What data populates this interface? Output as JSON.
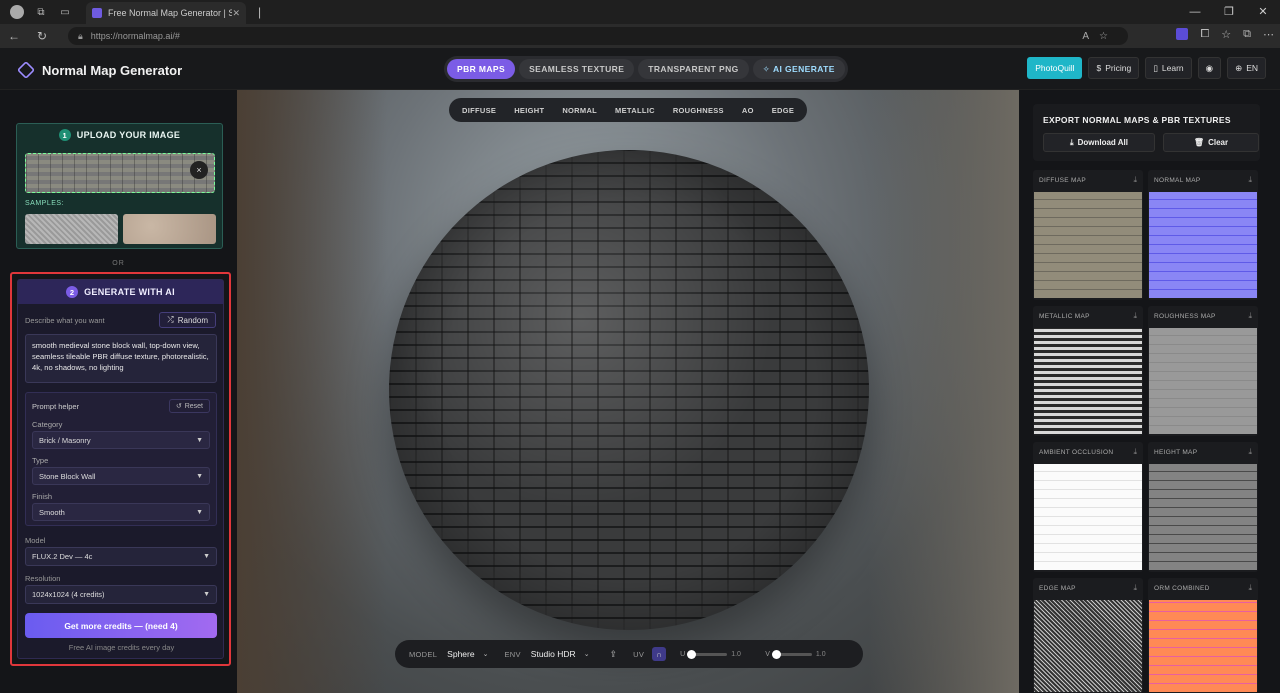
{
  "browser": {
    "tab_title": "Free Normal Map Generator | Sea",
    "tab_close": "✕",
    "url": "https://normalmap.ai/#",
    "window_buttons": [
      "—",
      "❐",
      "✕"
    ]
  },
  "header": {
    "app_title": "Normal Map Generator",
    "mode_tabs": [
      "PBR MAPS",
      "SEAMLESS TEXTURE",
      "TRANSPARENT PNG",
      "AI GENERATE"
    ],
    "photoquill": "PhotoQuill",
    "pricing": "Pricing",
    "learn": "Learn",
    "language": "EN"
  },
  "upload": {
    "step": "1",
    "title": "UPLOAD YOUR IMAGE",
    "remove": "×",
    "samples_label": "SAMPLES:"
  },
  "or_label": "OR",
  "ai": {
    "step": "2",
    "title": "GENERATE WITH AI",
    "describe_label": "Describe what you want",
    "random_label": "Random",
    "prompt": "smooth medieval stone block wall, top-down view, seamless tileable PBR diffuse texture, photorealistic, 4k, no shadows, no lighting",
    "helper": {
      "title": "Prompt helper",
      "reset": "Reset",
      "category_label": "Category",
      "category": "Brick / Masonry",
      "type_label": "Type",
      "type": "Stone Block Wall",
      "finish_label": "Finish",
      "finish": "Smooth"
    },
    "model_label": "Model",
    "model": "FLUX.2 Dev — 4c",
    "resolution_label": "Resolution",
    "resolution": "1024x1024 (4 credits)",
    "credits_button": "Get more credits — (need 4)",
    "free_note": "Free AI image credits every day"
  },
  "viewer": {
    "map_tabs": [
      "DIFFUSE",
      "HEIGHT",
      "NORMAL",
      "METALLIC",
      "ROUGHNESS",
      "AO",
      "EDGE"
    ],
    "model_label": "MODEL",
    "model": "Sphere",
    "env_label": "ENV",
    "env": "Studio HDR",
    "uv_label": "UV",
    "u_label": "U",
    "u_value": "1.0",
    "v_label": "V",
    "v_value": "1.0"
  },
  "export": {
    "title": "EXPORT NORMAL MAPS & PBR TEXTURES",
    "download_all": "Download All",
    "clear": "Clear"
  },
  "maps": [
    {
      "label": "DIFFUSE MAP"
    },
    {
      "label": "NORMAL MAP"
    },
    {
      "label": "METALLIC MAP"
    },
    {
      "label": "ROUGHNESS MAP"
    },
    {
      "label": "AMBIENT OCCLUSION"
    },
    {
      "label": "HEIGHT MAP"
    },
    {
      "label": "EDGE MAP"
    },
    {
      "label": "ORM COMBINED"
    }
  ]
}
